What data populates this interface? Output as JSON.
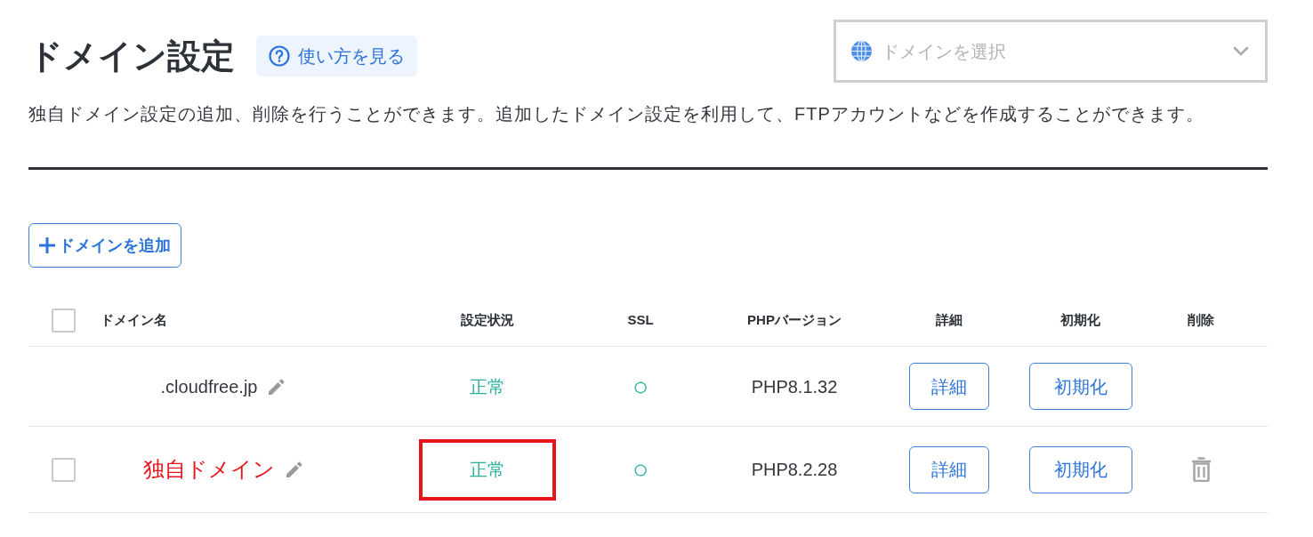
{
  "header": {
    "title": "ドメイン設定",
    "help_button": "使い方を見る",
    "domain_select": {
      "placeholder": "ドメインを選択"
    }
  },
  "description": "独自ドメイン設定の追加、削除を行うことができます。追加したドメイン設定を利用して、FTPアカウントなどを作成することができます。",
  "add_button": "ドメインを追加",
  "table": {
    "select_all": {
      "checked": false
    },
    "columns": [
      "ドメイン名",
      "設定状況",
      "SSL",
      "PHPバージョン",
      "詳細",
      "初期化",
      "削除"
    ],
    "rows": [
      {
        "domain": ".cloudfree.jp",
        "annotated": false,
        "status": "正常",
        "status_boxed": false,
        "ssl": "○",
        "php": "PHP8.1.32",
        "detail_button": "詳細",
        "reset_button": "初期化",
        "deletable": false
      },
      {
        "checkbox": {
          "checked": false
        },
        "domain": "独自ドメイン",
        "annotated": true,
        "status": "正常",
        "status_boxed": true,
        "ssl": "○",
        "php": "PHP8.2.28",
        "detail_button": "詳細",
        "reset_button": "初期化",
        "deletable": true
      }
    ]
  }
}
